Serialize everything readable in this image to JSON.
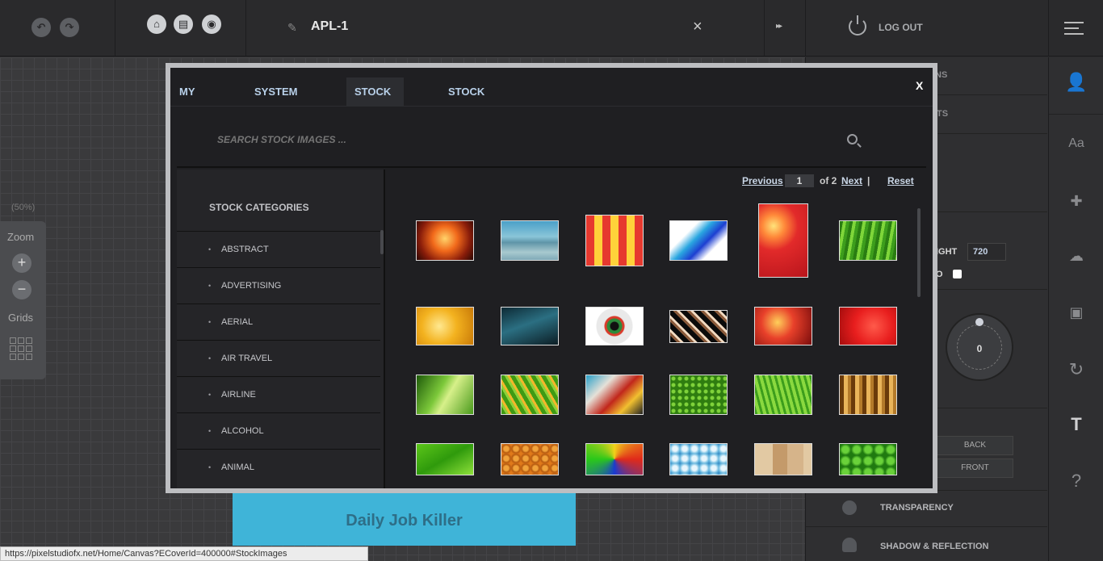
{
  "topbar": {
    "doc_title": "APL-1",
    "logout_label": "LOG OUT"
  },
  "canvas": {
    "zoom_percent": "(50%)",
    "zoom_label": "Zoom",
    "grids_label": "Grids",
    "design_text": "Daily Job Killer"
  },
  "props": {
    "partial_1": "NS",
    "partial_2": "TS",
    "height_label": "IGHT",
    "height_value": "720",
    "lock_label": "O",
    "rotation_value": "0",
    "back_label": "BACK",
    "front_label": "FRONT",
    "transparency_label": "TRANSPARENCY",
    "shadow_label": "SHADOW & REFLECTION"
  },
  "modal": {
    "tabs": [
      {
        "label": "MY IMAGES"
      },
      {
        "label": "SYSTEM IMAGES"
      },
      {
        "label": "STOCK IMAGES"
      },
      {
        "label": "STOCK ACCOUNTS"
      }
    ],
    "active_tab": "STOCK IMAGES",
    "close_label": "X",
    "search_placeholder": "SEARCH STOCK IMAGES ...",
    "categories_title": "STOCK CATEGORIES",
    "categories": [
      "ABSTRACT",
      "ADVERTISING",
      "AERIAL",
      "AIR TRAVEL",
      "AIRLINE",
      "ALCOHOL",
      "ANIMAL"
    ],
    "pager": {
      "previous": "Previous",
      "page": "1",
      "of_total": "of 2",
      "next": "Next",
      "separator": "|",
      "reset": "Reset"
    }
  },
  "status_url": "https://pixelstudiofx.net/Home/Canvas?ECoverId=400000#StockImages"
}
